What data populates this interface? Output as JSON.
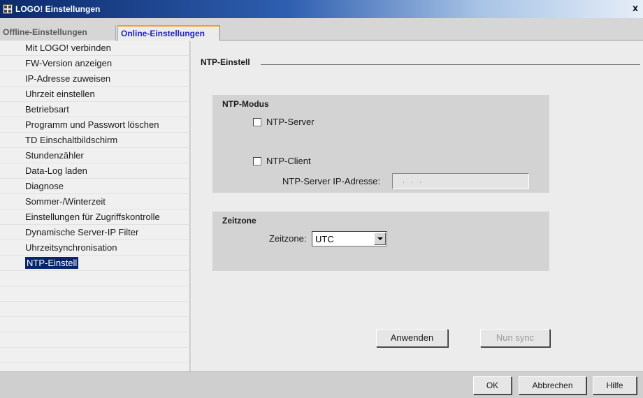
{
  "window": {
    "title": "LOGO! Einstellungen",
    "close": "x"
  },
  "tabs": [
    {
      "label": "Offline-Einstellungen",
      "active": false
    },
    {
      "label": "Online-Einstellungen",
      "active": true
    }
  ],
  "sidebar": {
    "items": [
      {
        "label": "Mit LOGO! verbinden"
      },
      {
        "label": "FW-Version anzeigen"
      },
      {
        "label": "IP-Adresse zuweisen"
      },
      {
        "label": "Uhrzeit einstellen"
      },
      {
        "label": "Betriebsart"
      },
      {
        "label": "Programm und Passwort löschen"
      },
      {
        "label": "TD Einschaltbildschirm"
      },
      {
        "label": "Stundenzähler"
      },
      {
        "label": "Data-Log laden"
      },
      {
        "label": "Diagnose"
      },
      {
        "label": "Sommer-/Winterzeit"
      },
      {
        "label": "Einstellungen für Zugriffskontrolle"
      },
      {
        "label": "Dynamische Server-IP Filter"
      },
      {
        "label": "Uhrzeitsynchronisation"
      },
      {
        "label": "NTP-Einstell",
        "selected": true
      }
    ]
  },
  "main": {
    "section_title": "NTP-Einstell",
    "ntp_mode": {
      "title": "NTP-Modus",
      "server_label": "NTP-Server",
      "server_checked": false,
      "client_label": "NTP-Client",
      "client_checked": false,
      "ip_label": "NTP-Server IP-Adresse:",
      "ip_value": ". . ."
    },
    "timezone": {
      "title": "Zeitzone",
      "label": "Zeitzone:",
      "value": "UTC"
    },
    "apply_label": "Anwenden",
    "sync_label": "Nun sync"
  },
  "footer": {
    "ok_label": "OK",
    "cancel_label": "Abbrechen",
    "help_label": "Hilfe"
  },
  "colors": {
    "selection": "#0a246a",
    "active_tab_text": "#1d23c8",
    "active_tab_accent": "#f3a021"
  }
}
